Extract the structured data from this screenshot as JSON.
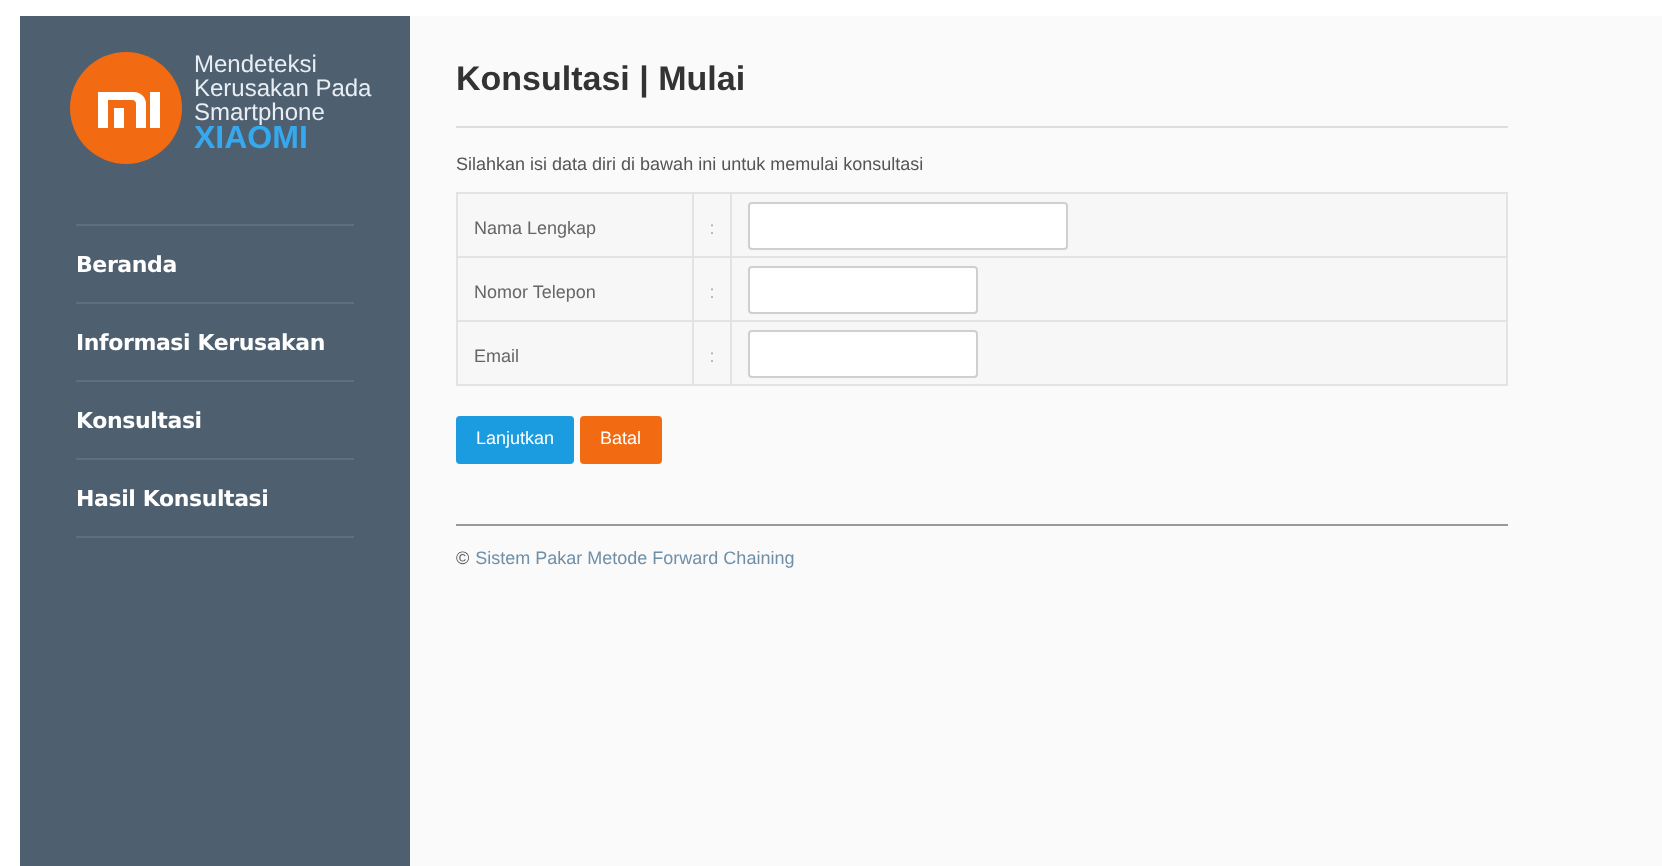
{
  "brand": {
    "lines": [
      "Mendeteksi",
      "Kerusakan Pada",
      "Smartphone"
    ],
    "name": "XIAOMI"
  },
  "nav": [
    {
      "label": "Beranda"
    },
    {
      "label": "Informasi Kerusakan"
    },
    {
      "label": "Konsultasi"
    },
    {
      "label": "Hasil Konsultasi"
    }
  ],
  "page": {
    "title": "Konsultasi | Mulai",
    "intro": "Silahkan isi data diri di bawah ini untuk memulai konsultasi"
  },
  "form": [
    {
      "label": "Nama Lengkap",
      "separator": ":",
      "kind": "wide"
    },
    {
      "label": "Nomor Telepon",
      "separator": ":",
      "kind": "narrow"
    },
    {
      "label": "Email",
      "separator": ":",
      "kind": "narrow"
    }
  ],
  "buttons": [
    {
      "label": "Lanjutkan",
      "kind": "primary"
    },
    {
      "label": "Batal",
      "kind": "cancel"
    }
  ],
  "footer": {
    "symbol": "©",
    "link": "Sistem Pakar Metode Forward Chaining"
  }
}
